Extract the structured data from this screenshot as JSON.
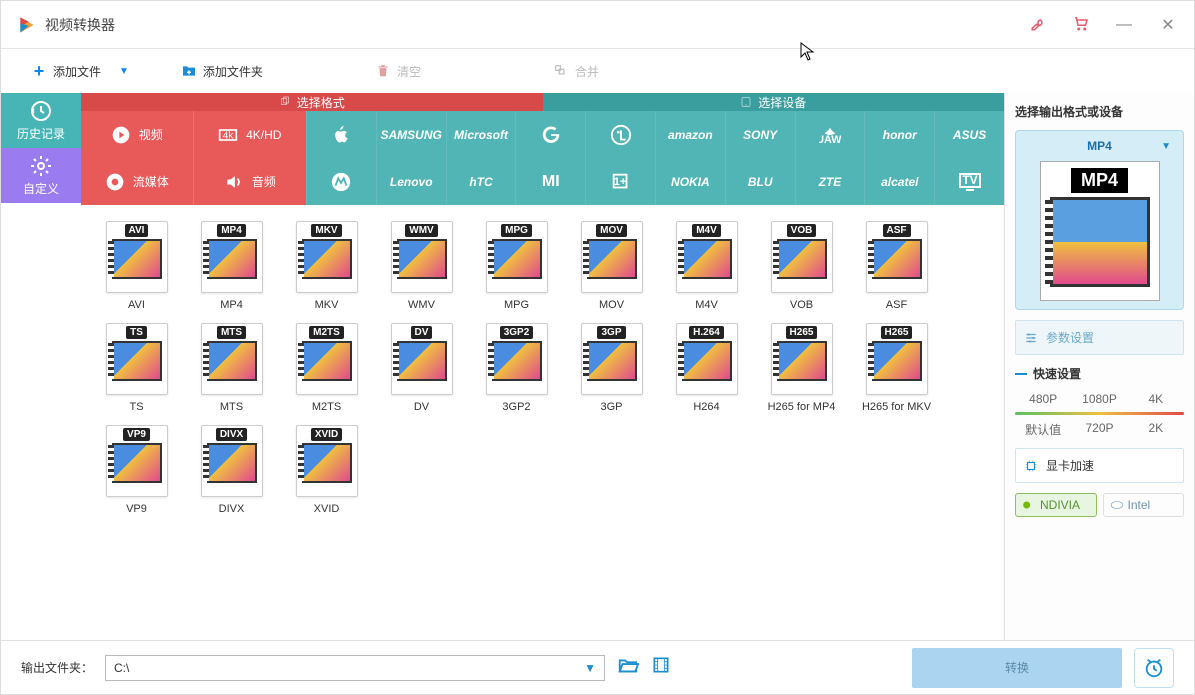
{
  "titlebar": {
    "title": "视频转换器"
  },
  "toolbar": {
    "add_file": "添加文件",
    "add_folder": "添加文件夹",
    "clear": "清空",
    "merge": "合并"
  },
  "sidebar": {
    "history": "历史记录",
    "custom": "自定义"
  },
  "tabs": {
    "format": "选择格式",
    "device": "选择设备"
  },
  "categories": {
    "video": "视频",
    "fk": "4K/HD",
    "stream": "流媒体",
    "audio": "音频"
  },
  "brands_row1": [
    "apple",
    "SAMSUNG",
    "Microsoft",
    "G",
    "LG",
    "amazon",
    "SONY",
    "HUAWEI",
    "honor",
    "ASUS"
  ],
  "brands_row2": [
    "moto",
    "Lenovo",
    "hTC",
    "mi",
    "oneplus",
    "NOKIA",
    "BLU",
    "ZTE",
    "alcatel",
    "TV"
  ],
  "formats": [
    {
      "badge": "AVI",
      "label": "AVI"
    },
    {
      "badge": "MP4",
      "label": "MP4"
    },
    {
      "badge": "MKV",
      "label": "MKV"
    },
    {
      "badge": "WMV",
      "label": "WMV"
    },
    {
      "badge": "MPG",
      "label": "MPG"
    },
    {
      "badge": "MOV",
      "label": "MOV"
    },
    {
      "badge": "M4V",
      "label": "M4V"
    },
    {
      "badge": "VOB",
      "label": "VOB"
    },
    {
      "badge": "ASF",
      "label": "ASF"
    },
    {
      "badge": "TS",
      "label": "TS"
    },
    {
      "badge": "MTS",
      "label": "MTS"
    },
    {
      "badge": "M2TS",
      "label": "M2TS"
    },
    {
      "badge": "DV",
      "label": "DV"
    },
    {
      "badge": "3GP2",
      "label": "3GP2"
    },
    {
      "badge": "3GP",
      "label": "3GP"
    },
    {
      "badge": "H.264",
      "label": "H264"
    },
    {
      "badge": "H265",
      "label": "H265 for MP4"
    },
    {
      "badge": "H265",
      "label": "H265 for MKV"
    },
    {
      "badge": "VP9",
      "label": "VP9"
    },
    {
      "badge": "DIVX",
      "label": "DIVX"
    },
    {
      "badge": "XVID",
      "label": "XVID"
    }
  ],
  "right": {
    "title": "选择输出格式或设备",
    "selected": "MP4",
    "selected_big": "MP4",
    "params": "参数设置",
    "quick": "快速设置",
    "presets": [
      "480P",
      "1080P",
      "4K"
    ],
    "presets2": [
      "默认值",
      "720P",
      "2K"
    ],
    "gpu_accel": "显卡加速",
    "nvidia": "NDIVIA",
    "intel": "Intel"
  },
  "bottom": {
    "out_label": "输出文件夹：",
    "out_path": "C:\\",
    "convert": "转换"
  }
}
